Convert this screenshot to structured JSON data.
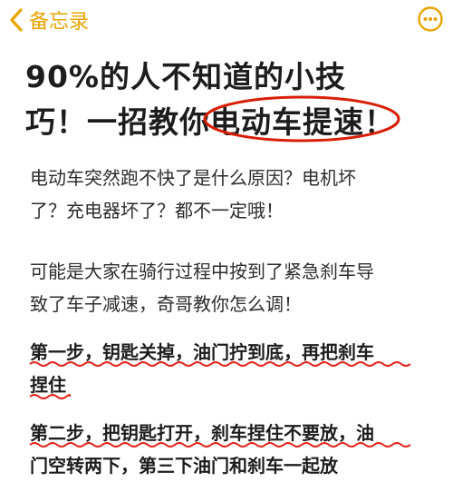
{
  "topbar": {
    "back_label": "备忘录",
    "accent_color": "#e8a400",
    "icons": [
      "chevron-left-icon",
      "more-icon"
    ]
  },
  "title": {
    "line1": "90%的人不知道的小技",
    "line2_prefix": "巧！一招教你",
    "line2_circled": "电动车提速",
    "line2_suffix": "！",
    "circle_color": "#d81e06"
  },
  "body": {
    "p1": [
      "电动车突然跑不快了是什么原因？电机坏",
      "了？充电器坏了？都不一定哦！"
    ],
    "p2": [
      "可能是大家在骑行过程中按到了紧急刹车导",
      "致了车子减速，奇哥教你怎么调！"
    ],
    "p3": [
      "第一步，钥匙关掉，油门拧到底，再把刹车",
      "捏住"
    ],
    "p4": [
      "第二步，把钥匙打开，刹车捏住不要放，油",
      "门空转两下，第三下油门和刹车一起放"
    ],
    "underline_color": "#e2231a"
  }
}
